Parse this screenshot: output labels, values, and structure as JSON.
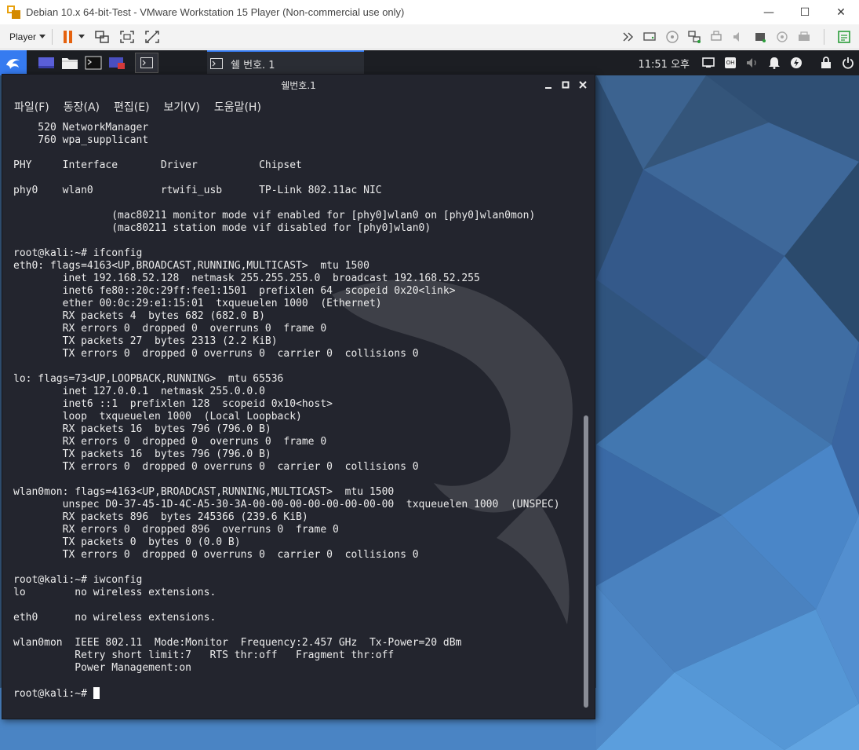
{
  "vmware": {
    "title": "Debian 10.x 64-bit-Test - VMware Workstation 15 Player (Non-commercial use only)",
    "player_label": "Player",
    "controls": {
      "minimize": "—",
      "maximize": "☐",
      "close": "✕"
    }
  },
  "panel": {
    "task_label": "쉘 번호. 1",
    "clock": "11:51 오후",
    "kbd_badge": "OH"
  },
  "terminal": {
    "title": "쉘번호.1",
    "menu": [
      "파일(F)",
      "동장(A)",
      "편집(E)",
      "보기(V)",
      "도움말(H)"
    ],
    "lines": [
      "    520 NetworkManager",
      "    760 wpa_supplicant",
      "",
      "PHY     Interface       Driver          Chipset",
      "",
      "phy0    wlan0           rtwifi_usb      TP-Link 802.11ac NIC",
      "",
      "                (mac80211 monitor mode vif enabled for [phy0]wlan0 on [phy0]wlan0mon)",
      "                (mac80211 station mode vif disabled for [phy0]wlan0)",
      "",
      "root@kali:~# ifconfig",
      "eth0: flags=4163<UP,BROADCAST,RUNNING,MULTICAST>  mtu 1500",
      "        inet 192.168.52.128  netmask 255.255.255.0  broadcast 192.168.52.255",
      "        inet6 fe80::20c:29ff:fee1:1501  prefixlen 64  scopeid 0x20<link>",
      "        ether 00:0c:29:e1:15:01  txqueuelen 1000  (Ethernet)",
      "        RX packets 4  bytes 682 (682.0 B)",
      "        RX errors 0  dropped 0  overruns 0  frame 0",
      "        TX packets 27  bytes 2313 (2.2 KiB)",
      "        TX errors 0  dropped 0 overruns 0  carrier 0  collisions 0",
      "",
      "lo: flags=73<UP,LOOPBACK,RUNNING>  mtu 65536",
      "        inet 127.0.0.1  netmask 255.0.0.0",
      "        inet6 ::1  prefixlen 128  scopeid 0x10<host>",
      "        loop  txqueuelen 1000  (Local Loopback)",
      "        RX packets 16  bytes 796 (796.0 B)",
      "        RX errors 0  dropped 0  overruns 0  frame 0",
      "        TX packets 16  bytes 796 (796.0 B)",
      "        TX errors 0  dropped 0 overruns 0  carrier 0  collisions 0",
      "",
      "wlan0mon: flags=4163<UP,BROADCAST,RUNNING,MULTICAST>  mtu 1500",
      "        unspec D0-37-45-1D-4C-A5-30-3A-00-00-00-00-00-00-00-00  txqueuelen 1000  (UNSPEC)",
      "        RX packets 896  bytes 245366 (239.6 KiB)",
      "        RX errors 0  dropped 896  overruns 0  frame 0",
      "        TX packets 0  bytes 0 (0.0 B)",
      "        TX errors 0  dropped 0 overruns 0  carrier 0  collisions 0",
      "",
      "root@kali:~# iwconfig",
      "lo        no wireless extensions.",
      "",
      "eth0      no wireless extensions.",
      "",
      "wlan0mon  IEEE 802.11  Mode:Monitor  Frequency:2.457 GHz  Tx-Power=20 dBm",
      "          Retry short limit:7   RTS thr:off   Fragment thr:off",
      "          Power Management:on",
      "",
      "root@kali:~# "
    ]
  },
  "colors": {
    "terminal_bg": "#23252e",
    "panel_bg": "#1c1e23",
    "accent_blue": "#367bf0",
    "pause_orange": "#e5620f"
  }
}
